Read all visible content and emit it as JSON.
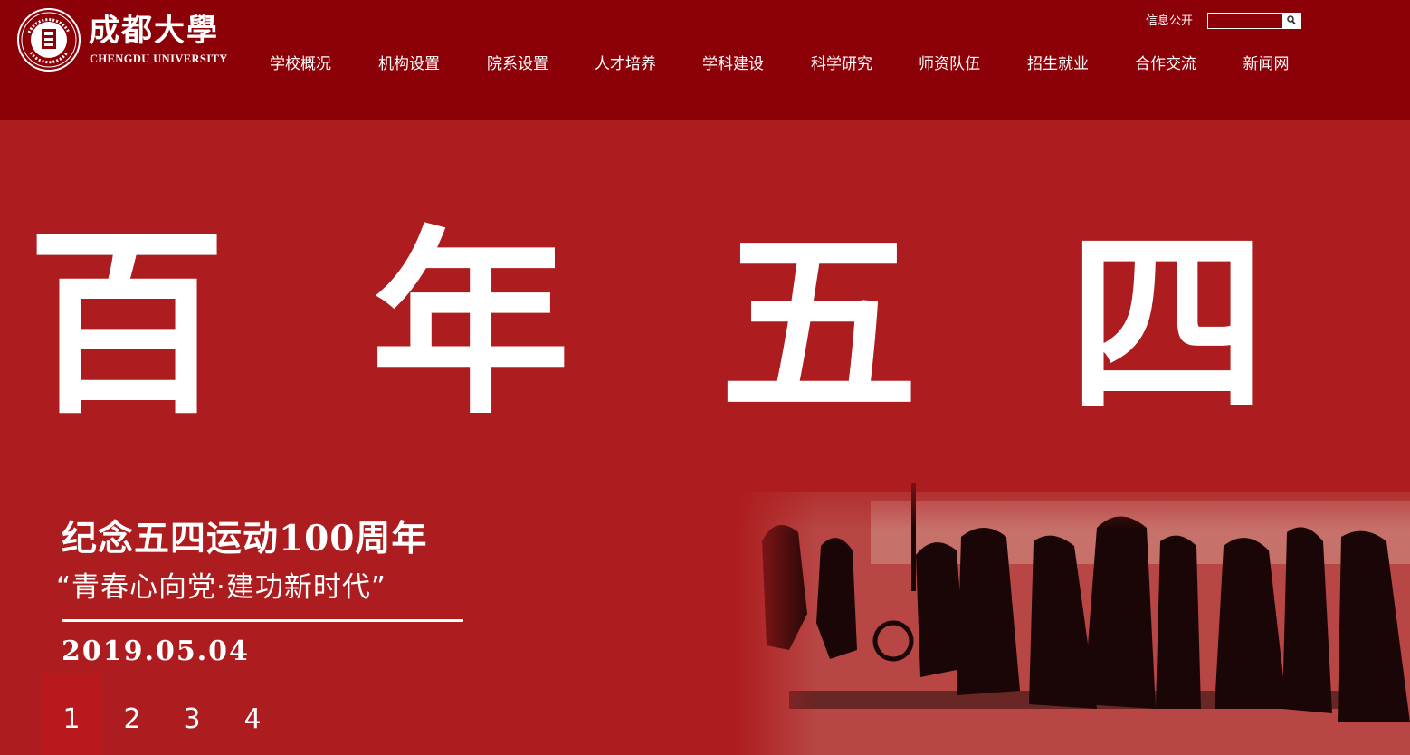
{
  "header": {
    "logo": {
      "name_cn": "成都大學",
      "name_en": "CHENGDU UNIVERSITY",
      "seal_text": "CHENGDU UNIVERSITY"
    },
    "info_link": "信息公开",
    "search": {
      "placeholder": "",
      "value": "",
      "icon": "search-icon"
    },
    "nav": [
      {
        "label": "学校概况"
      },
      {
        "label": "机构设置"
      },
      {
        "label": "院系设置"
      },
      {
        "label": "人才培养"
      },
      {
        "label": "学科建设"
      },
      {
        "label": "科学研究"
      },
      {
        "label": "师资队伍"
      },
      {
        "label": "招生就业"
      },
      {
        "label": "合作交流"
      },
      {
        "label": "新闻网"
      }
    ]
  },
  "banner": {
    "big_chars": [
      "百",
      "年",
      "五",
      "四"
    ],
    "subtitle": "纪念五四运动100周年",
    "slogan": "“青春心向党·建功新时代”",
    "date": "2019.05.04",
    "pager": [
      {
        "label": "1",
        "active": true
      },
      {
        "label": "2",
        "active": false
      },
      {
        "label": "3",
        "active": false
      },
      {
        "label": "4",
        "active": false
      }
    ]
  },
  "colors": {
    "header_bg": "#8c0008",
    "banner_bg": "#ad1c1e",
    "active_page": "#b9181d",
    "text": "#ffffff"
  }
}
